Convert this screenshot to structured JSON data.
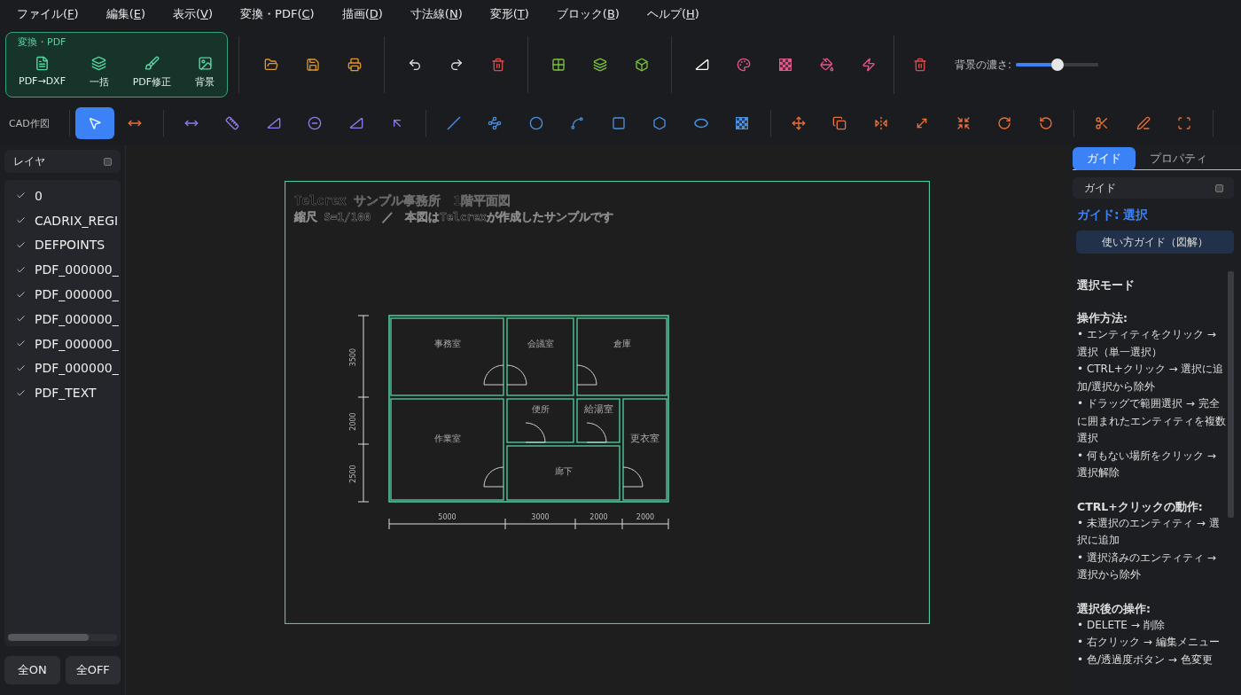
{
  "menu": [
    {
      "before": "ファイル(",
      "key": "F",
      "after": ")"
    },
    {
      "before": "編集(",
      "key": "E",
      "after": ")"
    },
    {
      "before": "表示(",
      "key": "V",
      "after": ")"
    },
    {
      "before": "変換・PDF(",
      "key": "C",
      "after": ")"
    },
    {
      "before": "描画(",
      "key": "D",
      "after": ")"
    },
    {
      "before": "寸法線(",
      "key": "N",
      "after": ")"
    },
    {
      "before": "変形(",
      "key": "T",
      "after": ")"
    },
    {
      "before": "ブロック(",
      "key": "B",
      "after": ")"
    },
    {
      "before": "ヘルプ(",
      "key": "H",
      "after": ")"
    }
  ],
  "pdf_group": {
    "title": "変換・PDF",
    "buttons": [
      "PDF→DXF",
      "一括",
      "PDF修正",
      "背景"
    ]
  },
  "background_slider": {
    "label": "背景の濃さ:",
    "level": 0.5
  },
  "cad_toolbar": {
    "label": "CAD作図",
    "tools": [
      {
        "selected": true
      },
      {
        "selected": false
      },
      {
        "selected": false
      },
      {
        "selected": false
      },
      {
        "selected": false
      },
      {
        "selected": false
      },
      {
        "selected": false
      },
      {
        "selected": false
      },
      {
        "selected": false
      },
      {
        "selected": false
      },
      {
        "selected": false
      },
      {
        "selected": false
      },
      {
        "selected": false
      },
      {
        "selected": false
      },
      {
        "selected": false
      },
      {
        "selected": false
      },
      {
        "selected": false
      },
      {
        "selected": false
      },
      {
        "selected": false
      },
      {
        "selected": false
      },
      {
        "selected": false
      },
      {
        "selected": false
      },
      {
        "selected": false
      },
      {
        "selected": false
      },
      {
        "selected": false
      },
      {
        "selected": false
      }
    ]
  },
  "layers": {
    "title": "レイヤ",
    "items": [
      {
        "name": "0",
        "checked": true
      },
      {
        "name": "CADRIX_REGI",
        "checked": true
      },
      {
        "name": "DEFPOINTS",
        "checked": true
      },
      {
        "name": "PDF_000000_",
        "checked": true
      },
      {
        "name": "PDF_000000_",
        "checked": true
      },
      {
        "name": "PDF_000000_",
        "checked": true
      },
      {
        "name": "PDF_000000_",
        "checked": true
      },
      {
        "name": "PDF_000000_",
        "checked": true
      },
      {
        "name": "PDF_TEXT",
        "checked": true
      }
    ],
    "buttons": [
      "全ON",
      "全OFF"
    ]
  },
  "drawing": {
    "title": "Telcrex サンプル事務所　1階平面図",
    "subtitle": "縮尺 S=1/100　／　本図はTelcrexが作成したサンプルです",
    "rooms": [
      "事務室",
      "会議室",
      "倉庫",
      "作業室",
      "便所",
      "給湯室",
      "廊下",
      "更衣室"
    ],
    "vertical_dims": [
      "3500",
      "2000",
      "2500"
    ],
    "horizontal_dims": [
      "5000",
      "3000",
      "2000",
      "2000"
    ]
  },
  "right_panel": {
    "tabs": [
      {
        "label": "ガイド",
        "selected": true
      },
      {
        "label": "プロパティ",
        "selected": false
      }
    ],
    "section_title": "ガイド",
    "heading": "ガイド: 選択",
    "guide_button": "使い方ガイド（図解）",
    "blocks": [
      {
        "title": "選択モード"
      },
      {
        "title": "操作方法:",
        "items": [
          "• エンティティをクリック → 選択（単一選択）",
          "• CTRL+クリック → 選択に追加/選択から除外",
          "• ドラッグで範囲選択 → 完全に囲まれたエンティティを複数選択",
          "• 何もない場所をクリック → 選択解除"
        ]
      },
      {
        "title": "CTRL+クリックの動作:",
        "items": [
          "• 未選択のエンティティ → 選択に追加",
          "• 選択済みのエンティティ → 選択から除外"
        ]
      },
      {
        "title": "選択後の操作:",
        "items": [
          "• DELETE → 削除",
          "• 右クリック → 編集メニュー",
          "• 色/透過度ボタン → 色変更"
        ]
      }
    ]
  }
}
